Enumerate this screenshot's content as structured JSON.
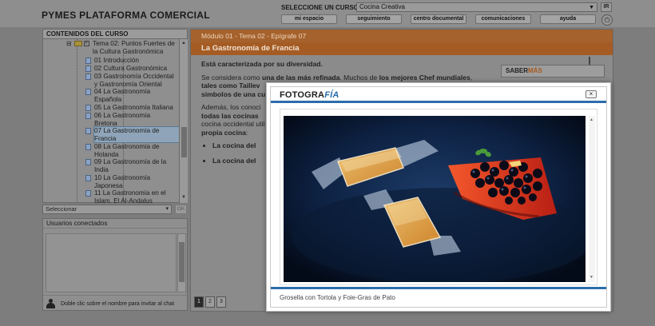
{
  "header": {
    "brand": "PYMES PLATAFORMA COMERCIAL",
    "course_label": "SELECCIONE UN CURSO:",
    "course_value": "Cocina Creativa",
    "go_label": "IR",
    "nav": [
      "mi espacio",
      "seguimiento",
      "centro documental",
      "comunicaciones",
      "ayuda"
    ]
  },
  "sidebar": {
    "title": "CONTENIDOS DEL CURSO",
    "folder": "Tema 02: Puntos Fuertes de la Cultura Gastronómica",
    "items": [
      "01 Introducción",
      "02 Cultura Gastronómica",
      "03 Gastronomía Occidental y Gastronomía Oriental",
      "04 La Gastronomía Española",
      "05 La Gastronomía Italiana",
      "06 La Gastronomía Bretona",
      "07 La Gastronomía de Francia",
      "08 La Gastronomía de Holanda",
      "09 La Gastronomía de la India",
      "10 La Gastronomía Japonesa",
      "11 La Gastronomía en el Islam. El Al-Andalus"
    ],
    "selected_index": 6,
    "select_placeholder": "Seleccionar",
    "ok_label": "OK"
  },
  "users": {
    "title": "Usuarios conectados",
    "hint": "Doble clic sobre el nombre para invitar al chat"
  },
  "main": {
    "breadcrumb": "Módulo 01 - Tema 02 - Epígrafe 07",
    "title": "La Gastronomía de Francia",
    "para1": "Está caracterizada por su diversidad.",
    "para2_a": "Se considera como ",
    "para2_b": "una de las más refinada",
    "para2_c": ". Muchos de ",
    "para2_d": "los mejores Chef mundiales",
    "para2_e": ",",
    "para2_f": "tales como Taillev",
    "para2_g": "simbolos de una cu",
    "para3_a": "Además, los conoci",
    "para3_b": "todas las cocinas",
    "para3_c": "cocina occidental util",
    "para3_d": "propia cocina",
    "para3_e": ":",
    "bullet1": "La cocina del",
    "bullet2": "La cocina del",
    "saber_a": "SABER",
    "saber_b": "MÁS",
    "pages": [
      "1",
      "2",
      "3"
    ]
  },
  "modal": {
    "title_a": "FOTOGRA",
    "title_b": "FÍA",
    "close": "×",
    "caption": "Grosella con Tortola y Foie-Gras de Pato"
  },
  "colors": {
    "accent_orange": "#e8761f",
    "modal_blue": "#2b6dab"
  }
}
